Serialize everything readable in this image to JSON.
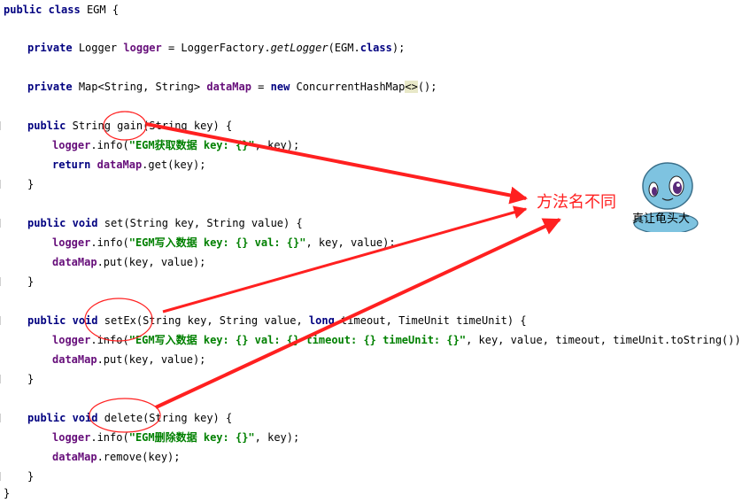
{
  "code": {
    "l1": {
      "kw1": "public",
      "kw2": "class",
      "name": "EGM {"
    },
    "l2": {
      "kw": "private",
      "type": "Logger ",
      "field": "logger",
      "eq": " = LoggerFactory.",
      "call": "getLogger",
      "arg": "(EGM.",
      "kw2": "class",
      "end": ");"
    },
    "l3": {
      "kw": "private",
      "type": "Map",
      "lt": "<",
      "generics": "String, String",
      "gt": ">",
      "field": "dataMap",
      "eq": " = ",
      "kw2": "new",
      "ctor": " ConcurrentHashMap",
      "diamond": "<>",
      "end": "();"
    },
    "l4": {
      "kw": "public",
      "sig": "String gain(String key) {"
    },
    "l5": {
      "field": "logger",
      "call": ".info(",
      "str": "\"EGM获取数据 key: {}\"",
      "rest": ", key);"
    },
    "l6": {
      "kw": "return",
      "field": "dataMap",
      "rest": ".get(key);"
    },
    "l7": {
      "text": "}"
    },
    "l8": {
      "kw1": "public",
      "kw2": "void",
      "sig": "set(String key, String value) {"
    },
    "l9": {
      "field": "logger",
      "call": ".info(",
      "str": "\"EGM写入数据 key: {} val: {}\"",
      "rest": ", key, value);"
    },
    "l10": {
      "field": "dataMap",
      "rest": ".put(key, value);"
    },
    "l11": {
      "text": "}"
    },
    "l12": {
      "kw1": "public",
      "kw2": "void",
      "sig1": "setEx(String key, String value, ",
      "kw3": "long",
      "sig2": " timeout, TimeUnit timeUnit) {"
    },
    "l13": {
      "field": "logger",
      "call": ".info(",
      "str": "\"EGM写入数据 key: {} val: {} timeout: {} timeUnit: {}\"",
      "rest": ", key, value, timeout, timeUnit.toString());"
    },
    "l14": {
      "field": "dataMap",
      "rest": ".put(key, value);"
    },
    "l15": {
      "text": "}"
    },
    "l16": {
      "kw1": "public",
      "kw2": "void",
      "sig": "delete(String key) {"
    },
    "l17": {
      "field": "logger",
      "call": ".info(",
      "str": "\"EGM删除数据 key: {}\"",
      "rest": ", key);"
    },
    "l18": {
      "field": "dataMap",
      "rest": ".remove(key);"
    },
    "l19": {
      "text": "}"
    },
    "l20": {
      "text": "}"
    }
  },
  "annotation": {
    "callout": "方法名不同",
    "sticker_caption": "真让龟头大",
    "color": "#ff2020"
  }
}
